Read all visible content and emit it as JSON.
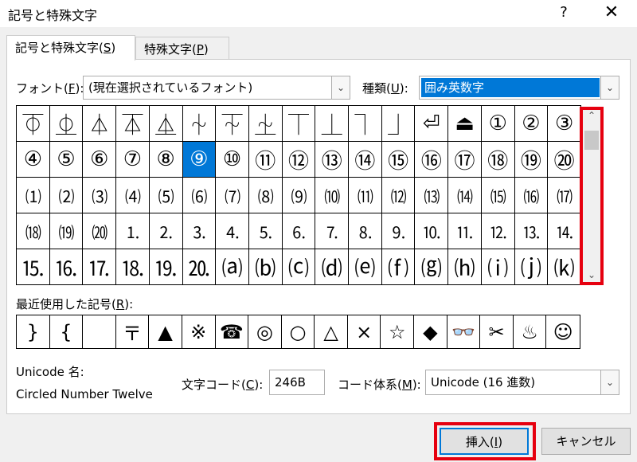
{
  "window": {
    "title": "記号と特殊文字",
    "help": "?",
    "close": "✕"
  },
  "tabs": [
    {
      "label": "記号と特殊文字(",
      "key": "S",
      "suffix": ")"
    },
    {
      "label": "特殊文字(",
      "key": "P",
      "suffix": ")"
    }
  ],
  "font": {
    "label": "フォント(",
    "key": "F",
    "suffix": "):",
    "value": "(現在選択されているフォント)"
  },
  "subset": {
    "label": "種類(",
    "key": "U",
    "suffix": "):",
    "value": "囲み英数字"
  },
  "symbols": [
    "⏁",
    "⏂",
    "⏃",
    "⏄",
    "⏅",
    "⏆",
    "⏇",
    "⏈",
    "⏉",
    "⏊",
    "⏋",
    "⏌",
    "⏎",
    "⏏",
    "①",
    "②",
    "③",
    "④",
    "⑤",
    "⑥",
    "⑦",
    "⑧",
    "⑨",
    "⑩",
    "⑪",
    "⑫",
    "⑬",
    "⑭",
    "⑮",
    "⑯",
    "⑰",
    "⑱",
    "⑲",
    "⑳",
    "⑴",
    "⑵",
    "⑶",
    "⑷",
    "⑸",
    "⑹",
    "⑺",
    "⑻",
    "⑼",
    "⑽",
    "⑾",
    "⑿",
    "⒀",
    "⒁",
    "⒂",
    "⒃",
    "⒄",
    "⒅",
    "⒆",
    "⒇",
    "⒈",
    "⒉",
    "⒊",
    "⒋",
    "⒌",
    "⒍",
    "⒎",
    "⒏",
    "⒐",
    "⒑",
    "⒒",
    "⒓",
    "⒔",
    "⒕",
    "⒖",
    "⒗",
    "⒘",
    "⒙",
    "⒚",
    "⒛",
    "⒜",
    "⒝",
    "⒞",
    "⒟",
    "⒠",
    "⒡",
    "⒢",
    "⒣",
    "⒤",
    "⒥",
    "⒦"
  ],
  "selected_index": 22,
  "recent": {
    "label": "最近使用した記号(",
    "key": "R",
    "suffix": "):",
    "items": [
      "}",
      "{",
      "",
      "〒",
      "▲",
      "※",
      "☎",
      "◎",
      "○",
      "△",
      "×",
      "☆",
      "◆",
      "👓",
      "✂",
      "♨",
      "☺"
    ]
  },
  "unicode_name": {
    "label": "Unicode 名:",
    "value": "Circled Number Twelve"
  },
  "char_code": {
    "label": "文字コード(",
    "key": "C",
    "suffix": "):",
    "value": "246B"
  },
  "code_system": {
    "label": "コード体系(",
    "key": "M",
    "suffix": "):",
    "value": "Unicode (16 進数)"
  },
  "buttons": {
    "insert": "挿入(",
    "insert_key": "I",
    "insert_suffix": ")",
    "cancel": "キャンセル"
  },
  "colors": {
    "selection": "#0078d7",
    "highlight": "#e6000f"
  }
}
